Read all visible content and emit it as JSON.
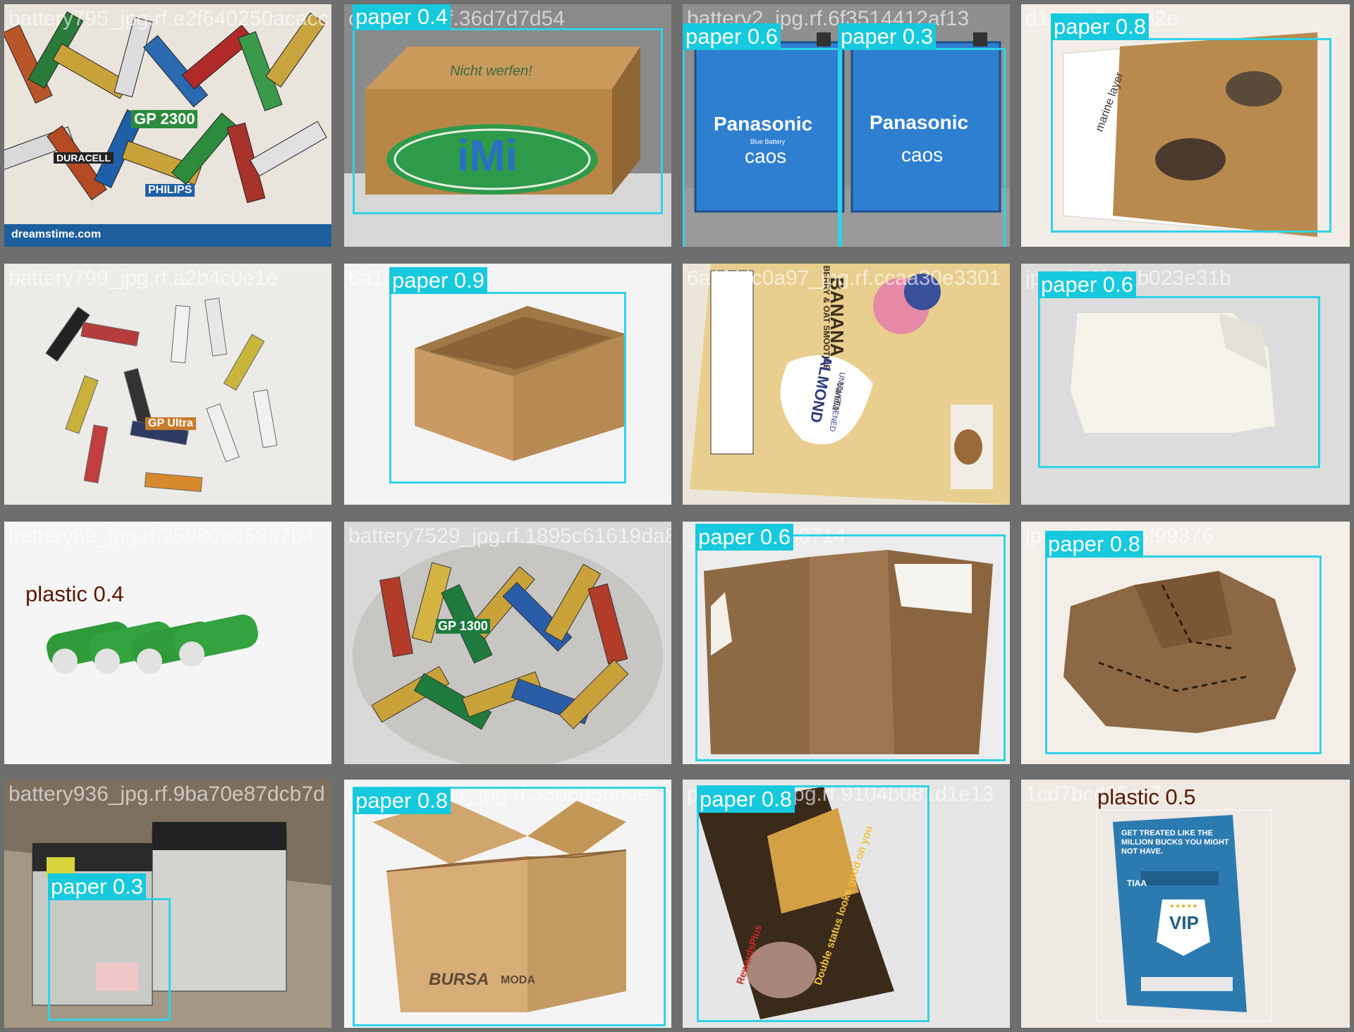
{
  "colors": {
    "paper_box": "#2fd3e6",
    "paper_label_bg": "#16c9de",
    "plastic_box": "#f4f4f4",
    "plastic_label_text": "#5a1800",
    "grid_bg": "#6e6e6e"
  },
  "tiles": [
    {
      "filename": "battery795_jpg.rf.e2f640250acacc",
      "detections": []
    },
    {
      "filename": "c341_jpg.rf.36d7d7d54",
      "detections": [
        {
          "label": "paper 0.4"
        }
      ]
    },
    {
      "filename": "battery2_jpg.rf.6f3514412af13",
      "detections": [
        {
          "label": "paper 0.6"
        },
        {
          "label": "paper 0.3"
        }
      ]
    },
    {
      "filename": "d1736b2aba82e",
      "detections": [
        {
          "label": "paper 0.8"
        }
      ]
    },
    {
      "filename": "battery799_jpg.rf.a2b4c0e1e",
      "detections": []
    },
    {
      "filename": "6a1fd4",
      "detections": [
        {
          "label": "paper 0.9"
        }
      ]
    },
    {
      "filename": "6a1fd4c0a97_jpg.rf.ccaa30e3301",
      "detections": []
    },
    {
      "filename": "jpg.rf.52b68b023e31b",
      "detections": [
        {
          "label": "paper 0.6"
        }
      ]
    },
    {
      "filename": "battery89_jpg.rf.25980a653a7b4",
      "detections": [
        {
          "label": "plastic 0.4"
        }
      ]
    },
    {
      "filename": "battery7529_jpg.rf.1895c61619da8",
      "detections": []
    },
    {
      "filename": "_jpg.rf.d1350714",
      "detections": [
        {
          "label": "paper 0.6"
        }
      ]
    },
    {
      "filename": "jpg.rf.8850a5f99376",
      "detections": [
        {
          "label": "paper 0.8"
        }
      ]
    },
    {
      "filename": "battery936_jpg.rf.9ba70e87dcb7d",
      "detections": [
        {
          "label": "paper 0.3"
        }
      ]
    },
    {
      "filename": "cardboard21_jpg.rf.3806d5bb0e",
      "detections": [
        {
          "label": "paper 0.8"
        }
      ]
    },
    {
      "filename": "paper195_jpg.rf.9104b081d1e13",
      "detections": [
        {
          "label": "paper 0.8"
        }
      ]
    },
    {
      "filename": "1cd7bcd25cc7",
      "detections": [
        {
          "label": "plastic 0.5"
        }
      ]
    }
  ],
  "text_on_images": {
    "imi_box_logo": "iMi",
    "imi_box_top": "Nicht werfen!",
    "panasonic_brand": "Panasonic",
    "panasonic_sub": "caos",
    "panasonic_blue_battery": "Blue Battery",
    "dreamstime": "dreamstime.com",
    "gp_label": "GP 2300",
    "philips": "PHILIPS",
    "duracell": "DURACELL",
    "gp_ultra": "GP Ultra",
    "gp_1300": "GP 1300",
    "milk_carton_1": "BANANA",
    "milk_carton_2": "BERRY & OAT SMOOTHIE",
    "milk_carton_3": "ALMOND",
    "milk_carton_4": "Vanilla",
    "milk_carton_5": "UNSWEETENED",
    "marine_layer": "marine layer",
    "bursa_box": "BURSA",
    "bursa_box_2": "MODA",
    "rewards_plus": "RewardsPlus",
    "double_status": "Double status looks good on you",
    "tiaa_headline": "GET TREATED LIKE THE MILLION BUCKS YOU MIGHT NOT HAVE.",
    "tiaa_brand": "TIAA",
    "tiaa_vip": "VIP",
    "tiaa_stars": "★★★★★"
  }
}
